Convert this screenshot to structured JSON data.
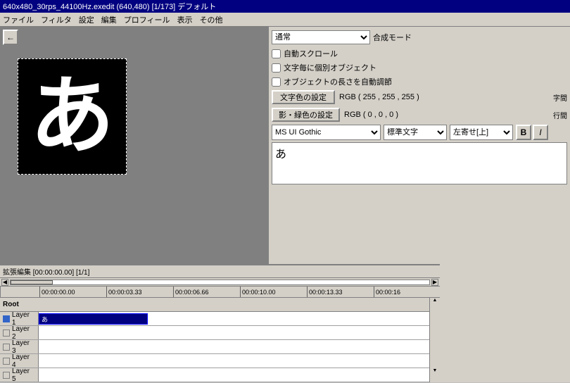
{
  "titlebar": {
    "text": "640x480_30rps_44100Hz.exedit (640,480) [1/173] デフォルト"
  },
  "menubar": {
    "items": [
      "ファイル",
      "フィルタ",
      "設定",
      "編集",
      "プロフィール",
      "表示",
      "その他"
    ]
  },
  "right_panel": {
    "blend_mode_label": "合成モード",
    "blend_mode_value": "通常",
    "checkboxes": [
      "自動スクロール",
      "文字毎に個別オブジェクト",
      "オブジェクトの長さを自動調節"
    ],
    "text_color_label": "文字色の設定",
    "text_color_value": "RGB ( 255 , 255 , 255 )",
    "shadow_color_label": "影・緑色の設定",
    "shadow_color_value": "RGB ( 0 , 0 , 0 )",
    "font_name": "MS UI Gothic",
    "font_style": "標準文字",
    "font_align": "左寄せ[上]",
    "bold_label": "B",
    "italic_label": "I",
    "text_content": "あ",
    "right_labels": [
      "字間",
      "行間"
    ]
  },
  "timeline": {
    "header_text": "拡張編集 [00:00:00.00] [1/1]",
    "time_marks": [
      "00:00:00.00",
      "00:00:03.33",
      "00:00:06.66",
      "00:00:10.00",
      "00:00:13.33",
      "00:00:16"
    ],
    "layers": [
      {
        "label": "Root",
        "type": "root",
        "clip": null,
        "color": null
      },
      {
        "label": "Layer 1",
        "type": "layer",
        "clip": "あ",
        "color": "#000080",
        "clip_width": 155
      },
      {
        "label": "Layer 2",
        "type": "layer",
        "clip": null,
        "color": null
      },
      {
        "label": "Layer 3",
        "type": "layer",
        "clip": null,
        "color": null
      },
      {
        "label": "Layer 4",
        "type": "layer",
        "clip": null,
        "color": null
      },
      {
        "label": "Layer 5",
        "type": "layer",
        "clip": null,
        "color": null
      }
    ]
  },
  "preview": {
    "char": "あ"
  }
}
